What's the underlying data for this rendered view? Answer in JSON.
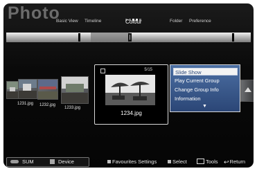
{
  "app": {
    "title": "Photo"
  },
  "view_tabs": [
    {
      "label": "Basic View",
      "active": false
    },
    {
      "label": "Timeline",
      "active": false
    },
    {
      "label": "Colour",
      "active": true
    },
    {
      "label": "Folder",
      "active": false
    },
    {
      "label": "Preference",
      "active": false
    }
  ],
  "thumbnails": [
    {
      "filename": "1231.jpg"
    },
    {
      "filename": "1232.jpg"
    },
    {
      "filename": "1233.jpg"
    }
  ],
  "focused_item": {
    "filename": "1234.jpg",
    "counter": "5/15"
  },
  "context_menu": {
    "items": [
      {
        "label": "Slide Show",
        "selected": true
      },
      {
        "label": "Play Current Group",
        "selected": false
      },
      {
        "label": "Change Group Info",
        "selected": false
      },
      {
        "label": "Information",
        "selected": false
      }
    ],
    "more_icon": "chevron-down-icon"
  },
  "bottom_bar": {
    "sum_label": "SUM",
    "device_label": "Device",
    "favourites_settings": "Favourites Settings",
    "select": "Select",
    "tools": "Tools",
    "return": "Return"
  },
  "colors": {
    "menu_bg": "#3a5a90",
    "menu_selected_bg": "#f3f3f3",
    "screen_bg": "#0a0a0a"
  }
}
